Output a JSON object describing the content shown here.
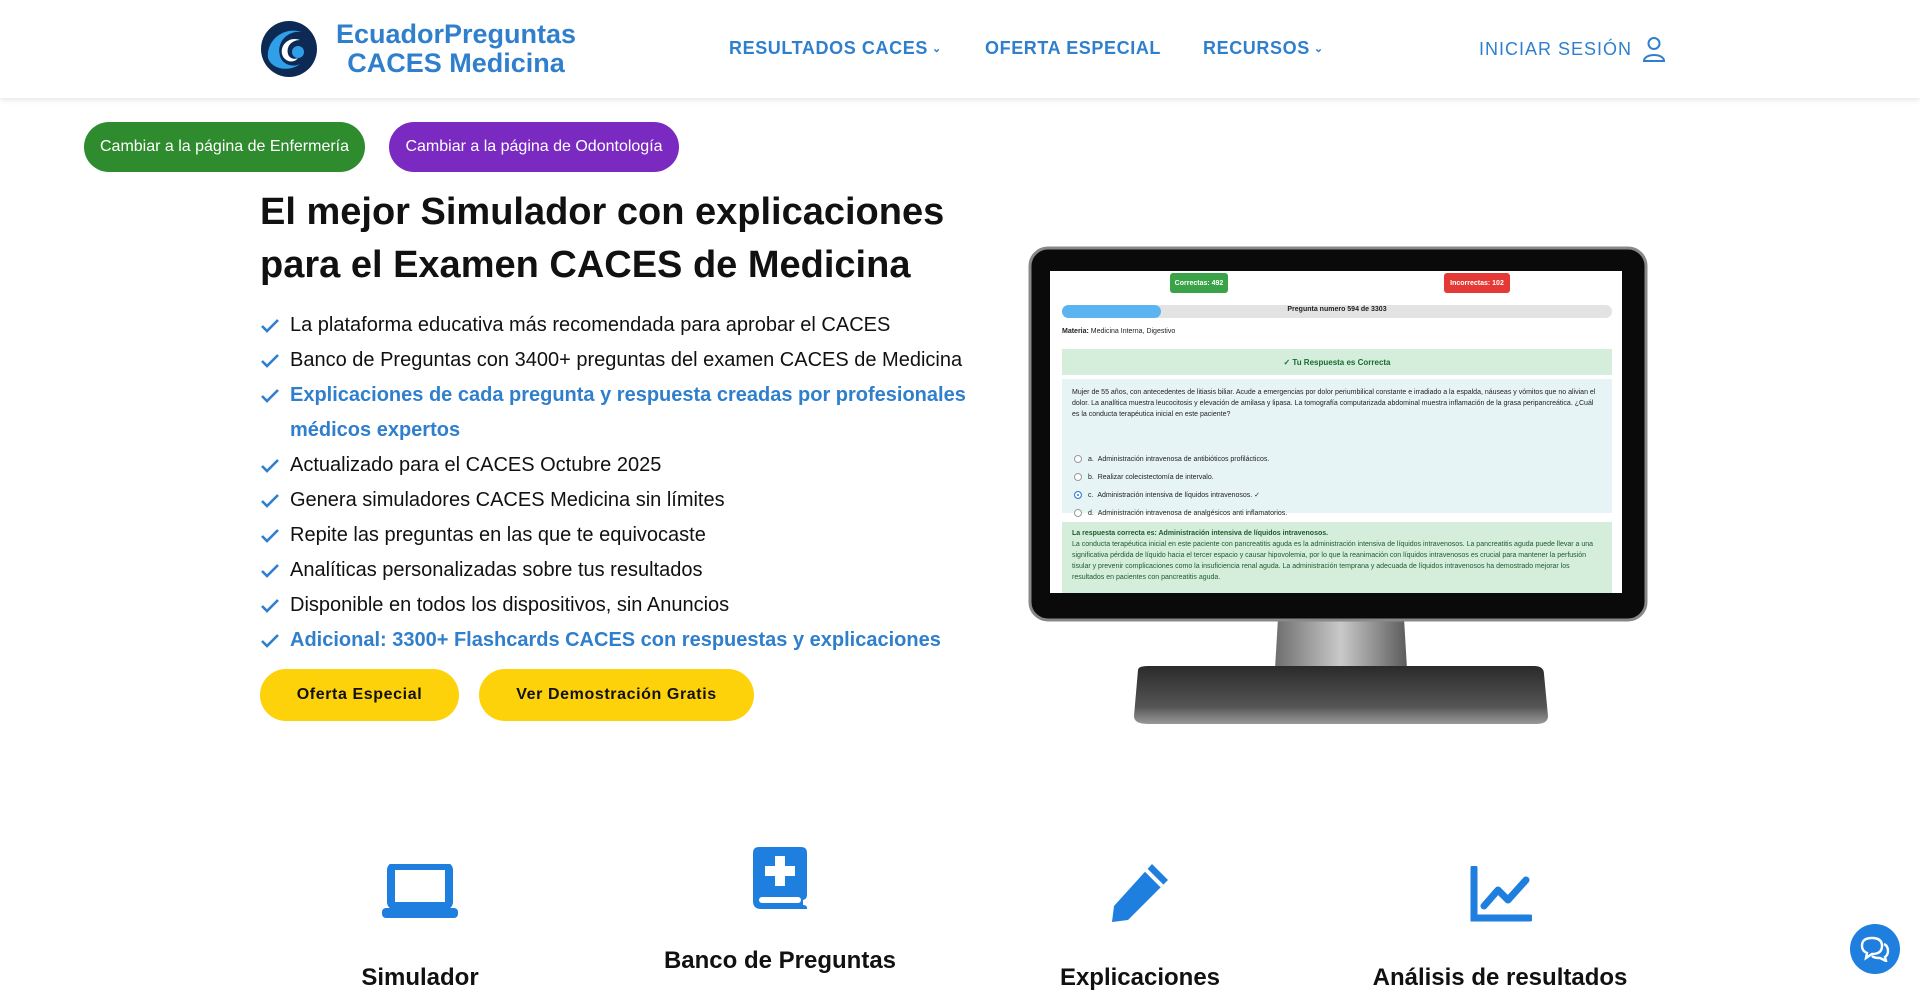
{
  "header": {
    "brand_line1": "EcuadorPreguntas",
    "brand_line2": "CACES Medicina",
    "nav": [
      {
        "label": "RESULTADOS CACES",
        "has_dropdown": true
      },
      {
        "label": "OFERTA ESPECIAL",
        "has_dropdown": false
      },
      {
        "label": "RECURSOS",
        "has_dropdown": true
      }
    ],
    "login_label": "INICIAR SESIÓN",
    "brand_color": "#2f7fcd"
  },
  "switch_buttons": {
    "nursing": {
      "label": "Cambiar a la página de Enfermería",
      "color": "#2e8b2e"
    },
    "dentistry": {
      "label": "Cambiar a la página de Odontología",
      "color": "#7b2ac1"
    }
  },
  "hero": {
    "title": "El mejor Simulador con explicaciones para el Examen CACES de Medicina",
    "features": [
      {
        "text": "La plataforma educativa más recomendada para aprobar el CACES",
        "highlight": false
      },
      {
        "text": "Banco de Preguntas con 3400+ preguntas del examen CACES de Medicina",
        "highlight": false
      },
      {
        "text": "Explicaciones de cada pregunta y respuesta creadas por profesionales médicos expertos",
        "highlight": true
      },
      {
        "text": "Actualizado para el CACES Octubre 2025",
        "highlight": false
      },
      {
        "text": "Genera simuladores CACES Medicina sin límites",
        "highlight": false
      },
      {
        "text": "Repite las preguntas en las que te equivocaste",
        "highlight": false
      },
      {
        "text": "Analíticas personalizadas sobre tus resultados",
        "highlight": false
      },
      {
        "text": "Disponible en todos los dispositivos, sin Anuncios",
        "highlight": false
      },
      {
        "text": "Adicional: 3300+ Flashcards CACES con respuestas y explicaciones",
        "highlight": true
      }
    ],
    "cta_offer": "Oferta Especial",
    "cta_demo": "Ver Demostración Gratis",
    "cta_color": "#fdd20b"
  },
  "monitor_screen": {
    "correct_badge": "Correctas: 492",
    "incorrect_badge": "Incorrectas: 102",
    "progress_fraction": 0.18,
    "question_number": "Pregunta numero 594 de 3303",
    "materia_label": "Materia:",
    "materia_value": "Medicina Interna, Digestivo",
    "result_banner": "✓ Tu Respuesta es Correcta",
    "question_text": "Mujer de 55 años, con antecedentes de litiasis biliar. Acude a emergencias por dolor periumbilical constante e irradiado a la espalda, náuseas y vómitos que no alivian el dolor. La analítica muestra leucocitosis y elevación de amilasa y lipasa. La tomografía computarizada abdominal muestra inflamación de la grasa peripancreática. ¿Cuál es la conducta terapéutica inicial en este paciente?",
    "options": [
      {
        "letter": "a.",
        "text": "Administración intravenosa de antibióticos profilácticos.",
        "selected": false
      },
      {
        "letter": "b.",
        "text": "Realizar colecistectomía de intervalo.",
        "selected": false
      },
      {
        "letter": "c.",
        "text": "Administración intensiva de líquidos intravenosos. ✓",
        "selected": true
      },
      {
        "letter": "d.",
        "text": "Administración intravenosa de analgésicos anti inflamatorios.",
        "selected": false
      }
    ],
    "answer_title": "La respuesta correcta es: Administración intensiva de líquidos intravenosos.",
    "answer_text": "La conducta terapéutica inicial en este paciente con pancreatitis aguda es la administración intensiva de líquidos intravenosos. La pancreatitis aguda puede llevar a una significativa pérdida de líquido hacia el tercer espacio y causar hipovolemia, por lo que la reanimación con líquidos intravenosos es crucial para mantener la perfusión tisular y prevenir complicaciones como la insuficiencia renal aguda. La administración temprana y adecuada de líquidos intravenosos ha demostrado mejorar los resultados en pacientes con pancreatitis aguda.",
    "correct_color": "#3aa347",
    "incorrect_color": "#e53935"
  },
  "feature_cards": [
    {
      "label": "Simulador",
      "icon": "laptop-icon"
    },
    {
      "label": "Banco de Preguntas",
      "icon": "medical-book-icon"
    },
    {
      "label": "Explicaciones",
      "icon": "pencil-icon"
    },
    {
      "label": "Análisis de resultados",
      "icon": "line-chart-icon"
    }
  ],
  "chat_icon": "chat-bubbles-icon"
}
